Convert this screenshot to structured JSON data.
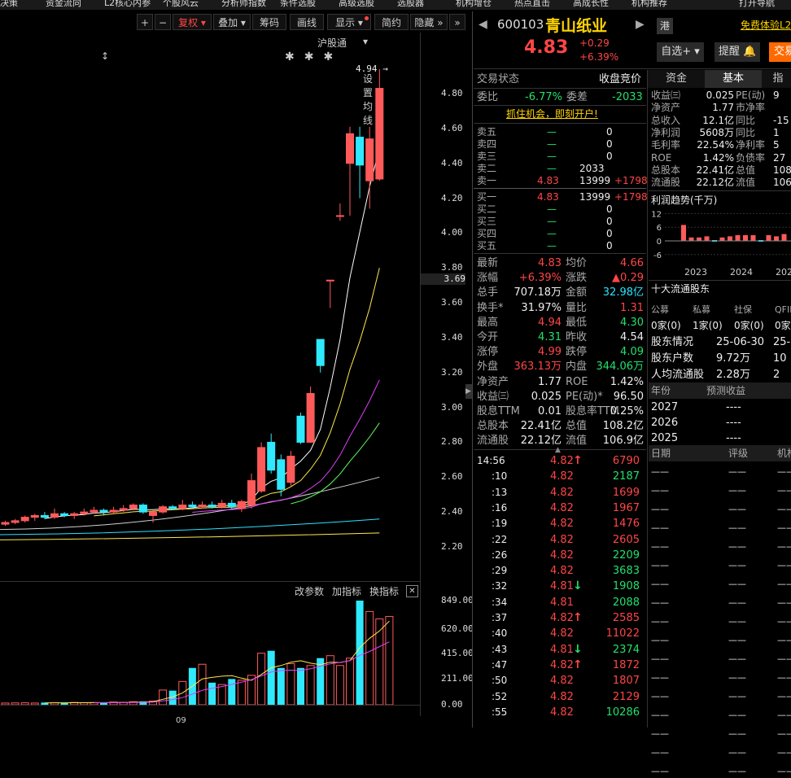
{
  "menu": [
    "决策",
    "资金流向",
    "L2核心内参",
    "个股风云",
    "分析师指数",
    "条件选股",
    "高级选股",
    "选股器",
    "机构增仓",
    "热点直击",
    "高成长性",
    "机构推荐",
    "打开导航"
  ],
  "toolbar": {
    "plus": "+",
    "minus": "−",
    "fuquan": "复权",
    "overlay": "叠加",
    "chips": "筹码",
    "draw": "画线",
    "display": "显示",
    "simple": "简约",
    "hide": "隐藏"
  },
  "subtool": {
    "hgt": "沪股通",
    "ma_settings": "设置均线"
  },
  "chart_data": {
    "type": "candlestick",
    "price_axis": [
      "4.80",
      "4.60",
      "4.40",
      "4.20",
      "4.00",
      "3.80",
      "3.60",
      "3.40",
      "3.20",
      "3.00",
      "2.80",
      "2.60",
      "2.40",
      "2.20"
    ],
    "current_price_tag": "3.69",
    "high_label": "4.94",
    "volume_axis": [
      "849.00",
      "620.00",
      "415.00",
      "211.00",
      "0.00"
    ],
    "x_label": "09",
    "candles": [
      {
        "o": 2.33,
        "c": 2.34,
        "h": 2.35,
        "l": 2.32
      },
      {
        "o": 2.34,
        "c": 2.35,
        "h": 2.36,
        "l": 2.33
      },
      {
        "o": 2.35,
        "c": 2.37,
        "h": 2.38,
        "l": 2.34
      },
      {
        "o": 2.37,
        "c": 2.38,
        "h": 2.39,
        "l": 2.35
      },
      {
        "o": 2.38,
        "c": 2.37,
        "h": 2.4,
        "l": 2.36
      },
      {
        "o": 2.37,
        "c": 2.39,
        "h": 2.42,
        "l": 2.36
      },
      {
        "o": 2.39,
        "c": 2.38,
        "h": 2.4,
        "l": 2.37
      },
      {
        "o": 2.38,
        "c": 2.39,
        "h": 2.4,
        "l": 2.36
      },
      {
        "o": 2.39,
        "c": 2.4,
        "h": 2.42,
        "l": 2.38
      },
      {
        "o": 2.4,
        "c": 2.41,
        "h": 2.43,
        "l": 2.39
      },
      {
        "o": 2.41,
        "c": 2.4,
        "h": 2.42,
        "l": 2.38
      },
      {
        "o": 2.4,
        "c": 2.41,
        "h": 2.43,
        "l": 2.39
      },
      {
        "o": 2.41,
        "c": 2.42,
        "h": 2.44,
        "l": 2.4
      },
      {
        "o": 2.42,
        "c": 2.44,
        "h": 2.45,
        "l": 2.41
      },
      {
        "o": 2.44,
        "c": 2.4,
        "h": 2.45,
        "l": 2.39
      },
      {
        "o": 2.38,
        "c": 2.4,
        "h": 2.41,
        "l": 2.34
      },
      {
        "o": 2.4,
        "c": 2.43,
        "h": 2.44,
        "l": 2.39
      },
      {
        "o": 2.43,
        "c": 2.42,
        "h": 2.44,
        "l": 2.41
      },
      {
        "o": 2.42,
        "c": 2.44,
        "h": 2.47,
        "l": 2.41
      },
      {
        "o": 2.44,
        "c": 2.43,
        "h": 2.46,
        "l": 2.42
      },
      {
        "o": 2.43,
        "c": 2.44,
        "h": 2.46,
        "l": 2.42
      },
      {
        "o": 2.44,
        "c": 2.43,
        "h": 2.46,
        "l": 2.42
      },
      {
        "o": 2.43,
        "c": 2.45,
        "h": 2.47,
        "l": 2.42
      },
      {
        "o": 2.45,
        "c": 2.43,
        "h": 2.47,
        "l": 2.42
      },
      {
        "o": 2.42,
        "c": 2.46,
        "h": 2.47,
        "l": 2.4
      },
      {
        "o": 2.44,
        "c": 2.58,
        "h": 2.62,
        "l": 2.42
      },
      {
        "o": 2.52,
        "c": 2.77,
        "h": 2.8,
        "l": 2.51
      },
      {
        "o": 2.8,
        "c": 2.64,
        "h": 2.85,
        "l": 2.62
      },
      {
        "o": 2.7,
        "c": 2.53,
        "h": 2.73,
        "l": 2.49
      },
      {
        "o": 2.57,
        "c": 2.72,
        "h": 2.75,
        "l": 2.55
      },
      {
        "o": 2.95,
        "c": 2.8,
        "h": 2.97,
        "l": 2.79
      },
      {
        "o": 2.8,
        "c": 3.08,
        "h": 3.12,
        "l": 2.8
      },
      {
        "o": 3.39,
        "c": 3.24,
        "h": 3.39,
        "l": 3.2
      },
      {
        "o": 3.73,
        "c": 3.73,
        "h": 3.73,
        "l": 3.57
      },
      {
        "o": 4.1,
        "c": 4.1,
        "h": 4.17,
        "l": 4.07
      },
      {
        "o": 4.4,
        "c": 4.57,
        "h": 4.61,
        "l": 4.1
      },
      {
        "o": 4.55,
        "c": 4.39,
        "h": 4.61,
        "l": 4.2
      },
      {
        "o": 4.3,
        "c": 4.54,
        "h": 4.61,
        "l": 4.14
      },
      {
        "o": 4.31,
        "c": 4.83,
        "h": 4.94,
        "l": 4.3
      }
    ],
    "volumes": [
      14,
      15,
      16,
      14,
      18,
      17,
      15,
      19,
      16,
      18,
      17,
      22,
      20,
      25,
      28,
      30,
      120,
      115,
      190,
      300,
      330,
      180,
      165,
      210,
      200,
      240,
      420,
      440,
      300,
      335,
      300,
      320,
      380,
      400,
      320,
      380,
      849,
      760,
      700,
      720
    ]
  },
  "indicator_bar": {
    "params": "改参数",
    "add": "加指标",
    "switch": "换指标"
  },
  "stock": {
    "code": "600103",
    "name": "青山纸业",
    "hk_badge": "港",
    "price": "4.83",
    "change": "+0.29",
    "change_pct": "+6.39%",
    "free_trial": "免费体验L2",
    "watch_btn": "自选+",
    "alert_btn": "提醒",
    "trade_btn": "交易"
  },
  "tabs": [
    "资金",
    "基本",
    "指"
  ],
  "status": {
    "label": "交易状态",
    "value": "收盘竞价"
  },
  "weibi": {
    "label": "委比",
    "value": "-6.77%",
    "diff_label": "委差",
    "diff_value": "-2033"
  },
  "promo": "抓住机会，即刻开户!",
  "asks": [
    {
      "label": "卖五",
      "price": "—",
      "vol": "0",
      "delta": ""
    },
    {
      "label": "卖四",
      "price": "—",
      "vol": "0",
      "delta": ""
    },
    {
      "label": "卖三",
      "price": "—",
      "vol": "0",
      "delta": ""
    },
    {
      "label": "卖二",
      "price": "—",
      "vol": "2033",
      "delta": ""
    },
    {
      "label": "卖一",
      "price": "4.83",
      "vol": "13999",
      "delta": "+1798"
    }
  ],
  "bids": [
    {
      "label": "买一",
      "price": "4.83",
      "vol": "13999",
      "delta": "+1798"
    },
    {
      "label": "买二",
      "price": "—",
      "vol": "0",
      "delta": ""
    },
    {
      "label": "买三",
      "price": "—",
      "vol": "0",
      "delta": ""
    },
    {
      "label": "买四",
      "price": "—",
      "vol": "0",
      "delta": ""
    },
    {
      "label": "买五",
      "price": "—",
      "vol": "0",
      "delta": ""
    }
  ],
  "stats": [
    [
      "最新",
      "4.83",
      "red",
      "均价",
      "4.66",
      "red"
    ],
    [
      "涨幅",
      "+6.39%",
      "red",
      "涨跌",
      "▲0.29",
      "red"
    ],
    [
      "总手",
      "707.18万",
      "white",
      "金额",
      "32.98亿",
      "cyan"
    ],
    [
      "换手*",
      "31.97%",
      "white",
      "量比",
      "1.31",
      "red"
    ],
    [
      "最高",
      "4.94",
      "red",
      "最低",
      "4.30",
      "green"
    ],
    [
      "今开",
      "4.31",
      "green",
      "昨收",
      "4.54",
      "white"
    ],
    [
      "涨停",
      "4.99",
      "red",
      "跌停",
      "4.09",
      "green"
    ],
    [
      "外盘",
      "363.13万",
      "red",
      "内盘",
      "344.06万",
      "green"
    ],
    [
      "净资产",
      "1.77",
      "white",
      "ROE",
      "1.42%",
      "white"
    ],
    [
      "收益㈢",
      "0.025",
      "white",
      "PE(动)*",
      "96.50",
      "white"
    ],
    [
      "股息TTM",
      "0.01",
      "white",
      "股息率TTM",
      "0.25%",
      "white"
    ],
    [
      "总股本",
      "22.41亿",
      "white",
      "总值",
      "108.2亿",
      "white"
    ],
    [
      "流通股",
      "22.12亿",
      "white",
      "流值",
      "106.9亿",
      "white"
    ]
  ],
  "ticks": [
    {
      "t": "14:56",
      "p": "4.82",
      "a": "↑",
      "v": "6790",
      "vc": "red"
    },
    {
      "t": ":10",
      "p": "4.82",
      "a": "",
      "v": "2187",
      "vc": "green"
    },
    {
      "t": ":13",
      "p": "4.82",
      "a": "",
      "v": "1699",
      "vc": "red"
    },
    {
      "t": ":16",
      "p": "4.82",
      "a": "",
      "v": "1967",
      "vc": "red"
    },
    {
      "t": ":19",
      "p": "4.82",
      "a": "",
      "v": "1476",
      "vc": "red"
    },
    {
      "t": ":22",
      "p": "4.82",
      "a": "",
      "v": "2605",
      "vc": "red"
    },
    {
      "t": ":26",
      "p": "4.82",
      "a": "",
      "v": "2209",
      "vc": "green"
    },
    {
      "t": ":29",
      "p": "4.82",
      "a": "",
      "v": "3683",
      "vc": "green"
    },
    {
      "t": ":32",
      "p": "4.81",
      "a": "↓",
      "v": "1908",
      "vc": "green"
    },
    {
      "t": ":34",
      "p": "4.81",
      "a": "",
      "v": "2088",
      "vc": "green"
    },
    {
      "t": ":37",
      "p": "4.82",
      "a": "↑",
      "v": "2585",
      "vc": "red"
    },
    {
      "t": ":40",
      "p": "4.82",
      "a": "",
      "v": "11022",
      "vc": "red"
    },
    {
      "t": ":43",
      "p": "4.81",
      "a": "↓",
      "v": "2374",
      "vc": "green"
    },
    {
      "t": ":47",
      "p": "4.82",
      "a": "↑",
      "v": "1872",
      "vc": "red"
    },
    {
      "t": ":50",
      "p": "4.82",
      "a": "",
      "v": "1807",
      "vc": "red"
    },
    {
      "t": ":52",
      "p": "4.82",
      "a": "",
      "v": "2129",
      "vc": "red"
    },
    {
      "t": ":55",
      "p": "4.82",
      "a": "",
      "v": "10286",
      "vc": "green"
    }
  ],
  "fundamentals": [
    [
      "收益㈢",
      "0.025",
      "PE(动)",
      "9"
    ],
    [
      "净资产",
      "1.77",
      "市净率",
      ""
    ],
    [
      "总收入",
      "12.1亿",
      "同比",
      "-15"
    ],
    [
      "净利润",
      "5608万",
      "同比",
      "1"
    ],
    [
      "毛利率",
      "22.54%",
      "净利率",
      "5"
    ],
    [
      "ROE",
      "1.42%",
      "负债率",
      "27"
    ],
    [
      "总股本",
      "22.41亿",
      "总值",
      "108"
    ],
    [
      "流通股",
      "22.12亿",
      "流值",
      "106"
    ]
  ],
  "profit_trend": {
    "title": "利润趋势(千万)",
    "y_ticks": [
      "12",
      "6",
      "0",
      "-6"
    ],
    "years": [
      "2023",
      "2024",
      "202"
    ],
    "bars": [
      7,
      1.5,
      1.5,
      2,
      0,
      1.5,
      2,
      2.5,
      2.5,
      2.5,
      0,
      2.5,
      2,
      3
    ]
  },
  "holders": {
    "title": "十大流通股东",
    "cols": [
      "公募",
      "私募",
      "社保",
      "QFII"
    ],
    "vals": [
      "0家(0)",
      "1家(0)",
      "0家(0)",
      "0家"
    ],
    "rows": [
      [
        "股东情况",
        "25-06-30",
        "25-0"
      ],
      [
        "股东户数",
        "9.72万",
        "10"
      ],
      [
        "人均流通股",
        "2.28万",
        "2"
      ]
    ]
  },
  "forecast": {
    "cols": [
      "年份",
      "预测收益"
    ],
    "rows": [
      [
        "2027",
        "----"
      ],
      [
        "2026",
        "----"
      ],
      [
        "2025",
        "----"
      ]
    ]
  },
  "ratings": {
    "cols": [
      "日期",
      "评级",
      "机构"
    ],
    "placeholder": "——"
  }
}
